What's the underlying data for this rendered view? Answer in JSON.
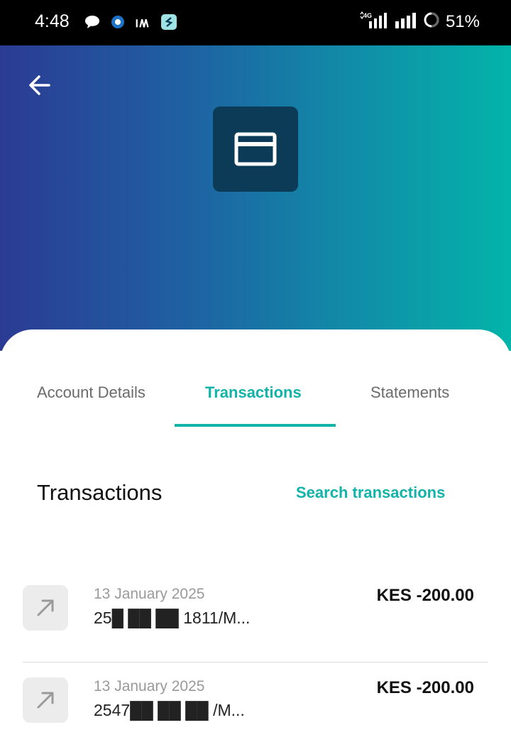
{
  "status_bar": {
    "time": "4:48",
    "battery_percent": "51%",
    "network_label": "4G",
    "notification_icons": [
      "chat-bubble-icon",
      "app-badge-icon",
      "im-icon",
      "s-app-icon"
    ]
  },
  "header": {
    "back_icon": "arrow-left-icon",
    "card_icon": "credit-card-icon"
  },
  "tabs": [
    {
      "label": "Account Details",
      "active": false
    },
    {
      "label": "Transactions",
      "active": true
    },
    {
      "label": "Statements",
      "active": false
    }
  ],
  "transactions_section": {
    "title": "Transactions",
    "search_label": "Search transactions",
    "items": [
      {
        "date": "13 January 2025",
        "reference": "25█ ██ ██ 1811/M...",
        "amount": "KES -200.00",
        "icon": "arrow-up-right-icon"
      },
      {
        "date": "13 January 2025",
        "reference": "2547██ ██ ██ /M...",
        "amount": "KES -200.00",
        "icon": "arrow-up-right-icon"
      }
    ]
  },
  "colors": {
    "accent": "#12b3a8",
    "hero_gradient_start": "#2b3b93",
    "hero_gradient_end": "#03b4a9",
    "card_tile": "#0b3b56"
  }
}
